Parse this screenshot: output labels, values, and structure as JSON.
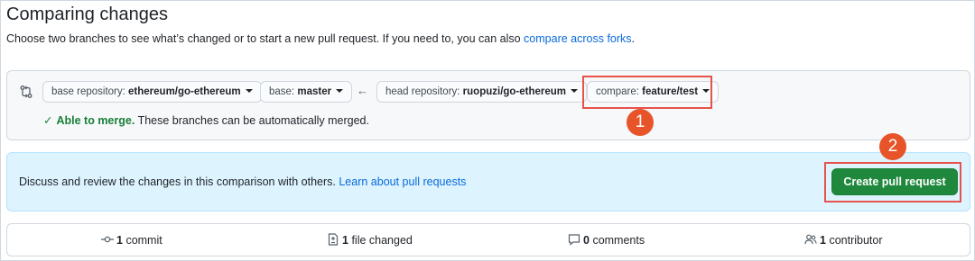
{
  "header": {
    "title": "Comparing changes",
    "subtitle": "Choose two branches to see what’s changed or to start a new pull request. If you need to, you can also",
    "subtitle_link": "compare across forks",
    "subtitle_end": "."
  },
  "range": {
    "base_repo_label": "base repository:",
    "base_repo_value": "ethereum/go-ethereum",
    "base_label": "base:",
    "base_value": "master",
    "arrow": "←",
    "head_repo_label": "head repository:",
    "head_repo_value": "ruopuzi/go-ethereum",
    "compare_label": "compare:",
    "compare_value": "feature/test",
    "merge_strong": "Able to merge.",
    "merge_text": "These branches can be automatically merged."
  },
  "flash": {
    "text": "Discuss and review the changes in this comparison with others.",
    "link": "Learn about pull requests",
    "button": "Create pull request"
  },
  "stats": {
    "commits_count": "1",
    "commits_label": "commit",
    "files_count": "1",
    "files_label": "file changed",
    "comments_count": "0",
    "comments_label": "comments",
    "contributors_count": "1",
    "contributors_label": "contributor"
  },
  "annotations": {
    "step1": "1",
    "step2": "2",
    "color": "#e5534b"
  },
  "colors": {
    "accent_green": "#1f883d",
    "link_blue": "#0969da",
    "flash_bg": "#ddf4ff"
  }
}
